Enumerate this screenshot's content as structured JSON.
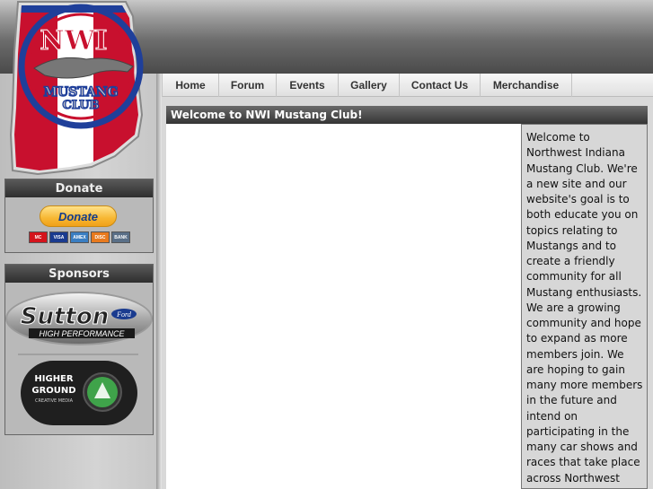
{
  "site": {
    "logo_text_top": "NWI",
    "logo_text_middle": "MUSTANG",
    "logo_text_bottom": "CLUB"
  },
  "nav": {
    "items": [
      {
        "label": "Home"
      },
      {
        "label": "Forum"
      },
      {
        "label": "Events"
      },
      {
        "label": "Gallery"
      },
      {
        "label": "Contact Us"
      },
      {
        "label": "Merchandise"
      }
    ]
  },
  "donate": {
    "title": "Donate",
    "button_label": "Donate",
    "cards": [
      "MC",
      "VISA",
      "AMEX",
      "DISC",
      "BANK"
    ]
  },
  "sponsors": {
    "title": "Sponsors",
    "sponsor1_name": "Sutton",
    "sponsor1_brand": "Ford",
    "sponsor1_tagline": "HIGH PERFORMANCE",
    "sponsor2_line1": "HIGHER",
    "sponsor2_line2": "GROUND",
    "sponsor2_line3": "CREATIVE MEDIA"
  },
  "main": {
    "title": "Welcome to NWI Mustang Club!",
    "body": "Welcome to Northwest Indiana Mustang Club. We're a new site and our website's goal is to both educate you on topics relating to Mustangs and to create a friendly community for all Mustang enthusiasts. We are a growing community and hope to expand as more members join. We are hoping to gain many more members in the future and intend on participating in the many car shows and races that take place across Northwest Indiana. Not only does our site consists of"
  },
  "colors": {
    "flag_red": "#c8102e",
    "flag_blue": "#1f3f9a",
    "paypal_yellow": "#f7b733"
  }
}
